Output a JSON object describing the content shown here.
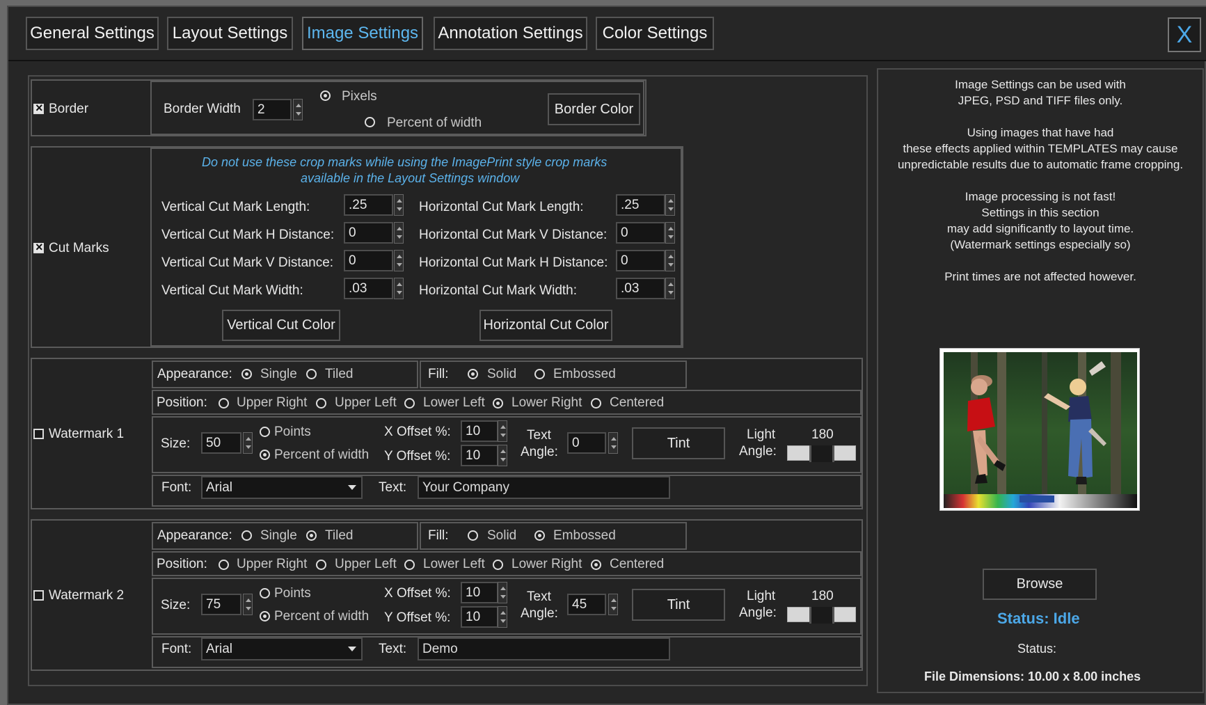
{
  "tabs": [
    {
      "label": "General Settings",
      "active": false
    },
    {
      "label": "Layout Settings",
      "active": false
    },
    {
      "label": "Image Settings",
      "active": true
    },
    {
      "label": "Annotation Settings",
      "active": false
    },
    {
      "label": "Color Settings",
      "active": false
    }
  ],
  "close_label": "X",
  "border": {
    "checkbox_label": "Border",
    "checked": true,
    "width_label": "Border Width",
    "width_value": "2",
    "pixels_label": "Pixels",
    "percent_label": "Percent of width",
    "selected_unit": "pixels",
    "color_button": "Border Color"
  },
  "cut_marks": {
    "checkbox_label": "Cut Marks",
    "checked": true,
    "notice_line1": "Do not use these crop marks while using the ImagePrint style crop marks",
    "notice_line2": "available in the Layout Settings window",
    "vertical_length_label": "Vertical Cut Mark Length:",
    "vertical_length_value": ".25",
    "vertical_h_label": "Vertical Cut Mark H Distance:",
    "vertical_h_value": "0",
    "vertical_v_label": "Vertical Cut Mark V Distance:",
    "vertical_v_value": "0",
    "vertical_width_label": "Vertical Cut Mark Width:",
    "vertical_width_value": ".03",
    "horizontal_length_label": "Horizontal Cut Mark Length:",
    "horizontal_length_value": ".25",
    "horizontal_v_label": "Horizontal Cut Mark V Distance:",
    "horizontal_v_value": "0",
    "horizontal_h_label": "Horizontal Cut Mark H Distance:",
    "horizontal_h_value": "0",
    "horizontal_width_label": "Horizontal Cut Mark Width:",
    "horizontal_width_value": ".03",
    "vertical_color_button": "Vertical Cut Color",
    "horizontal_color_button": "Horizontal Cut Color"
  },
  "watermark1": {
    "checkbox_label": "Watermark 1",
    "checked": false,
    "appearance_label": "Appearance:",
    "single_label": "Single",
    "tiled_label": "Tiled",
    "appearance_selected": "single",
    "fill_label": "Fill:",
    "solid_label": "Solid",
    "embossed_label": "Embossed",
    "fill_selected": "solid",
    "position_label": "Position:",
    "positions": [
      "Upper Right",
      "Upper Left",
      "Lower Left",
      "Lower Right",
      "Centered"
    ],
    "position_selected": "Lower Right",
    "size_label": "Size:",
    "size_value": "50",
    "points_label": "Points",
    "percent_label": "Percent of width",
    "size_unit_selected": "percent",
    "x_offset_label": "X Offset %:",
    "x_offset_value": "10",
    "y_offset_label": "Y Offset %:",
    "y_offset_value": "10",
    "text_angle_label1": "Text",
    "text_angle_label2": "Angle:",
    "text_angle_value": "0",
    "tint_button": "Tint",
    "light_angle_label1": "Light",
    "light_angle_label2": "Angle:",
    "light_angle_value": "180",
    "font_label": "Font:",
    "font_value": "Arial",
    "text_label": "Text:",
    "text_value": "Your Company"
  },
  "watermark2": {
    "checkbox_label": "Watermark 2",
    "checked": false,
    "appearance_label": "Appearance:",
    "single_label": "Single",
    "tiled_label": "Tiled",
    "appearance_selected": "tiled",
    "fill_label": "Fill:",
    "solid_label": "Solid",
    "embossed_label": "Embossed",
    "fill_selected": "embossed",
    "position_label": "Position:",
    "positions": [
      "Upper Right",
      "Upper Left",
      "Lower Left",
      "Lower Right",
      "Centered"
    ],
    "position_selected": "Centered",
    "size_label": "Size:",
    "size_value": "75",
    "points_label": "Points",
    "percent_label": "Percent of width",
    "size_unit_selected": "percent",
    "x_offset_label": "X Offset %:",
    "x_offset_value": "10",
    "y_offset_label": "Y Offset %:",
    "y_offset_value": "10",
    "text_angle_label1": "Text",
    "text_angle_label2": "Angle:",
    "text_angle_value": "45",
    "tint_button": "Tint",
    "light_angle_label1": "Light",
    "light_angle_label2": "Angle:",
    "light_angle_value": "180",
    "font_label": "Font:",
    "font_value": "Arial",
    "text_label": "Text:",
    "text_value": "Demo"
  },
  "info": {
    "line1": "Image Settings can be used with",
    "line2": "JPEG, PSD and TIFF files only.",
    "line3": "Using images that have had",
    "line4": "these effects applied within TEMPLATES may cause",
    "line5": "unpredictable results due to automatic frame cropping.",
    "line6": "Image processing is not fast!",
    "line7": "Settings in this section",
    "line8": "may add significantly to layout time.",
    "line9": "(Watermark settings especially so)",
    "line10": "Print times are not affected however."
  },
  "browse_button": "Browse",
  "status_idle": "Status: Idle",
  "status_label": "Status:",
  "file_dimensions": "File Dimensions: 10.00 x 8.00 inches"
}
